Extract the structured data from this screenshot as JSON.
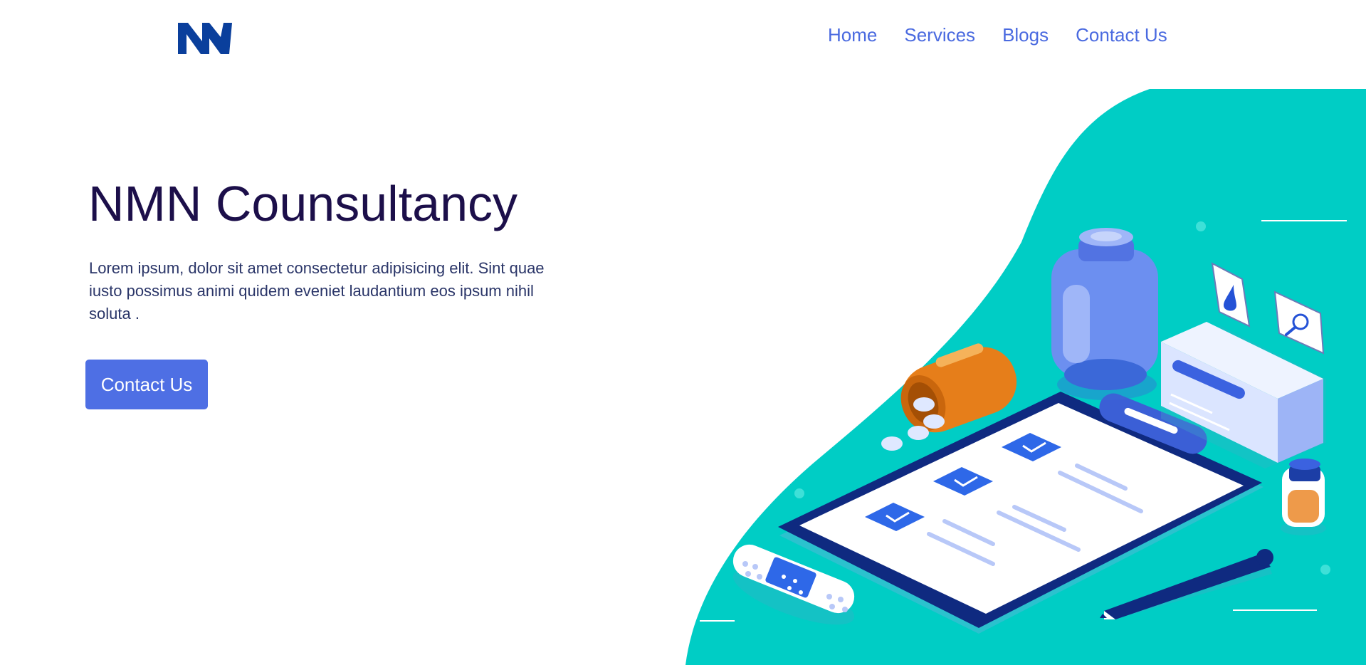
{
  "brand": {
    "logo_text": "NM",
    "color": "#0a3f9c"
  },
  "nav": {
    "items": [
      "Home",
      "Services",
      "Blogs",
      "Contact Us"
    ],
    "color": "#4a6ae0"
  },
  "hero": {
    "title": "NMN Counsultancy",
    "description": "Lorem ipsum, dolor sit amet consectetur adipisicing elit. Sint quae iusto possimus animi quidem eveniet laudantium eos ipsum nihil soluta .",
    "cta_label": "Contact Us",
    "cta_color": "#4e6fe4"
  },
  "illustration": {
    "background_color": "#00cdc5",
    "icons": [
      "pill-bottle-icon",
      "spilled-pill-bottle-icon",
      "clipboard-icon",
      "medicine-box-icon",
      "blood-drop-icon",
      "magnifier-icon",
      "bandage-icon",
      "vial-icon",
      "pen-icon"
    ]
  }
}
